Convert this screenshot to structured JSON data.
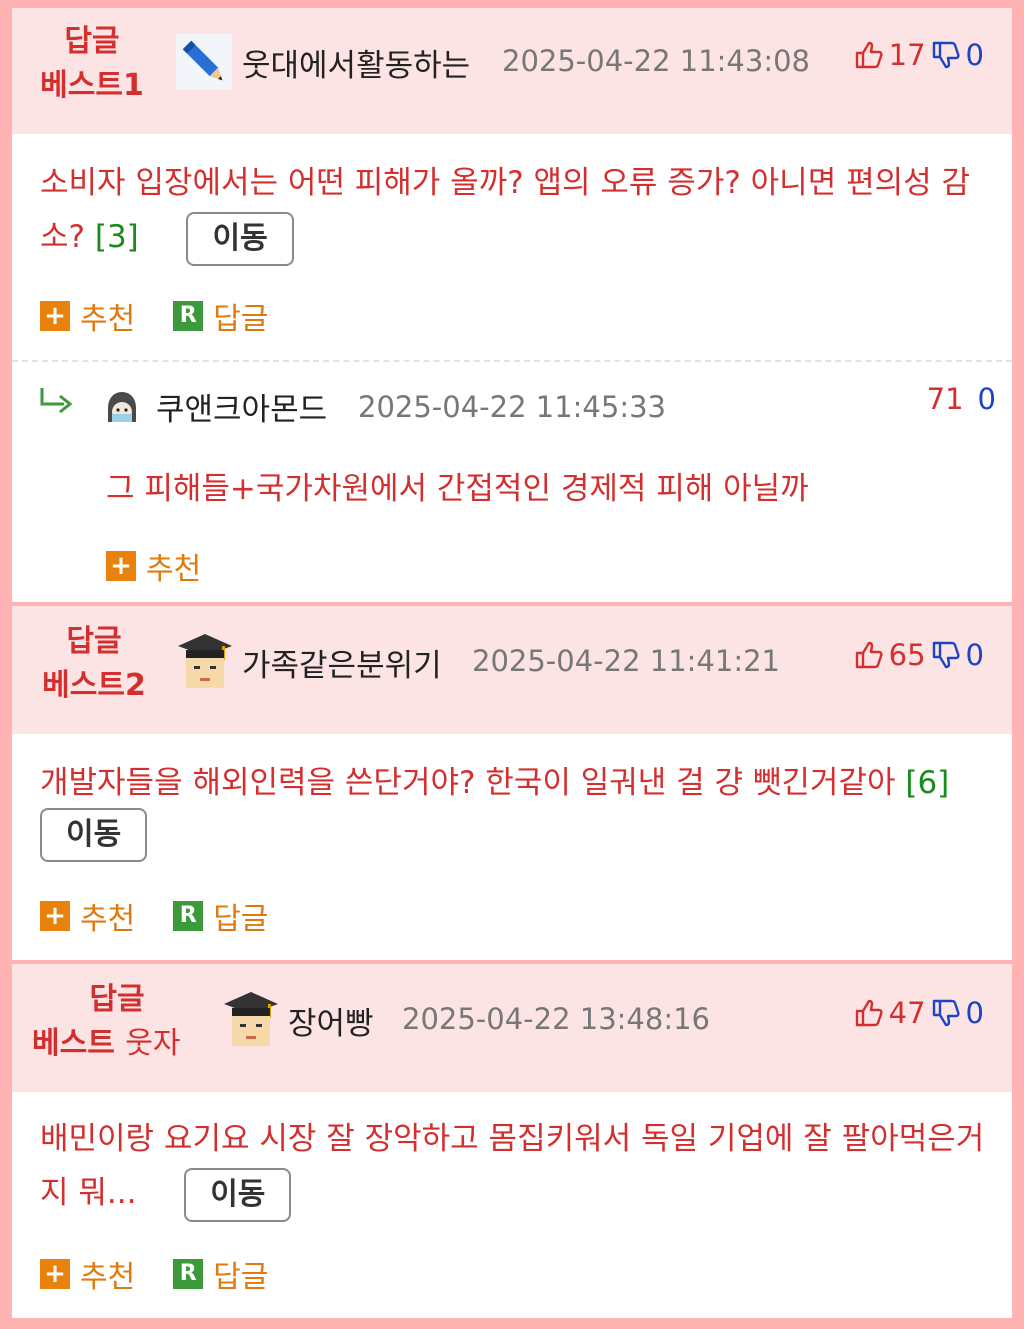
{
  "comments": [
    {
      "badge_line1": "답글",
      "badge_line2": "베스트1",
      "avatar_icon": "pencil-icon",
      "nickname": "웃대에서활동하는",
      "date": "2025-04-22 11:43:08",
      "up": "17",
      "down": "0",
      "text": "소비자 입장에서는 어떤 피해가 올까? 앱의 오류 증가? 아니면 편의성 감소?",
      "reply_count": "[3]",
      "move_label": "이동",
      "recommend_label": "추천",
      "reply_label": "답글"
    },
    {
      "badge_line1": "답글",
      "badge_line2": "베스트2",
      "avatar_icon": "graduate-avatar-icon",
      "nickname": "가족같은분위기",
      "date": "2025-04-22 11:41:21",
      "up": "65",
      "down": "0",
      "text": "개발자들을 해외인력을 쓴단거야? 한국이 일궈낸 걸 걍 뺏긴거같아",
      "reply_count": "[6]",
      "move_label": "이동",
      "recommend_label": "추천",
      "reply_label": "답글"
    },
    {
      "badge_line1": "답글",
      "badge_line2a": "베스트",
      "badge_line2b": "웃자",
      "avatar_icon": "graduate-avatar-icon",
      "nickname": "장어빵",
      "date": "2025-04-22 13:48:16",
      "up": "47",
      "down": "0",
      "text": "배민이랑 요기요 시장 잘 장악하고 몸집키워서 독일 기업에 잘 팔아먹은거지 뭐...",
      "move_label": "이동",
      "recommend_label": "추천",
      "reply_label": "답글"
    }
  ],
  "reply": {
    "avatar_icon": "anime-girl-avatar-icon",
    "nickname": "쿠앤크아몬드",
    "date": "2025-04-22 11:45:33",
    "up": "71",
    "down": "0",
    "text": "그 피해들+국가차원에서 간접적인 경제적 피해 아닐까",
    "recommend_label": "추천"
  },
  "colors": {
    "page_bg": "#ffb3b3",
    "header_bg": "#fde4e4",
    "accent_red": "#d32f2f",
    "down_blue": "#1a44c9",
    "count_green": "#1b8a1b",
    "action_orange": "#e07a0f"
  }
}
